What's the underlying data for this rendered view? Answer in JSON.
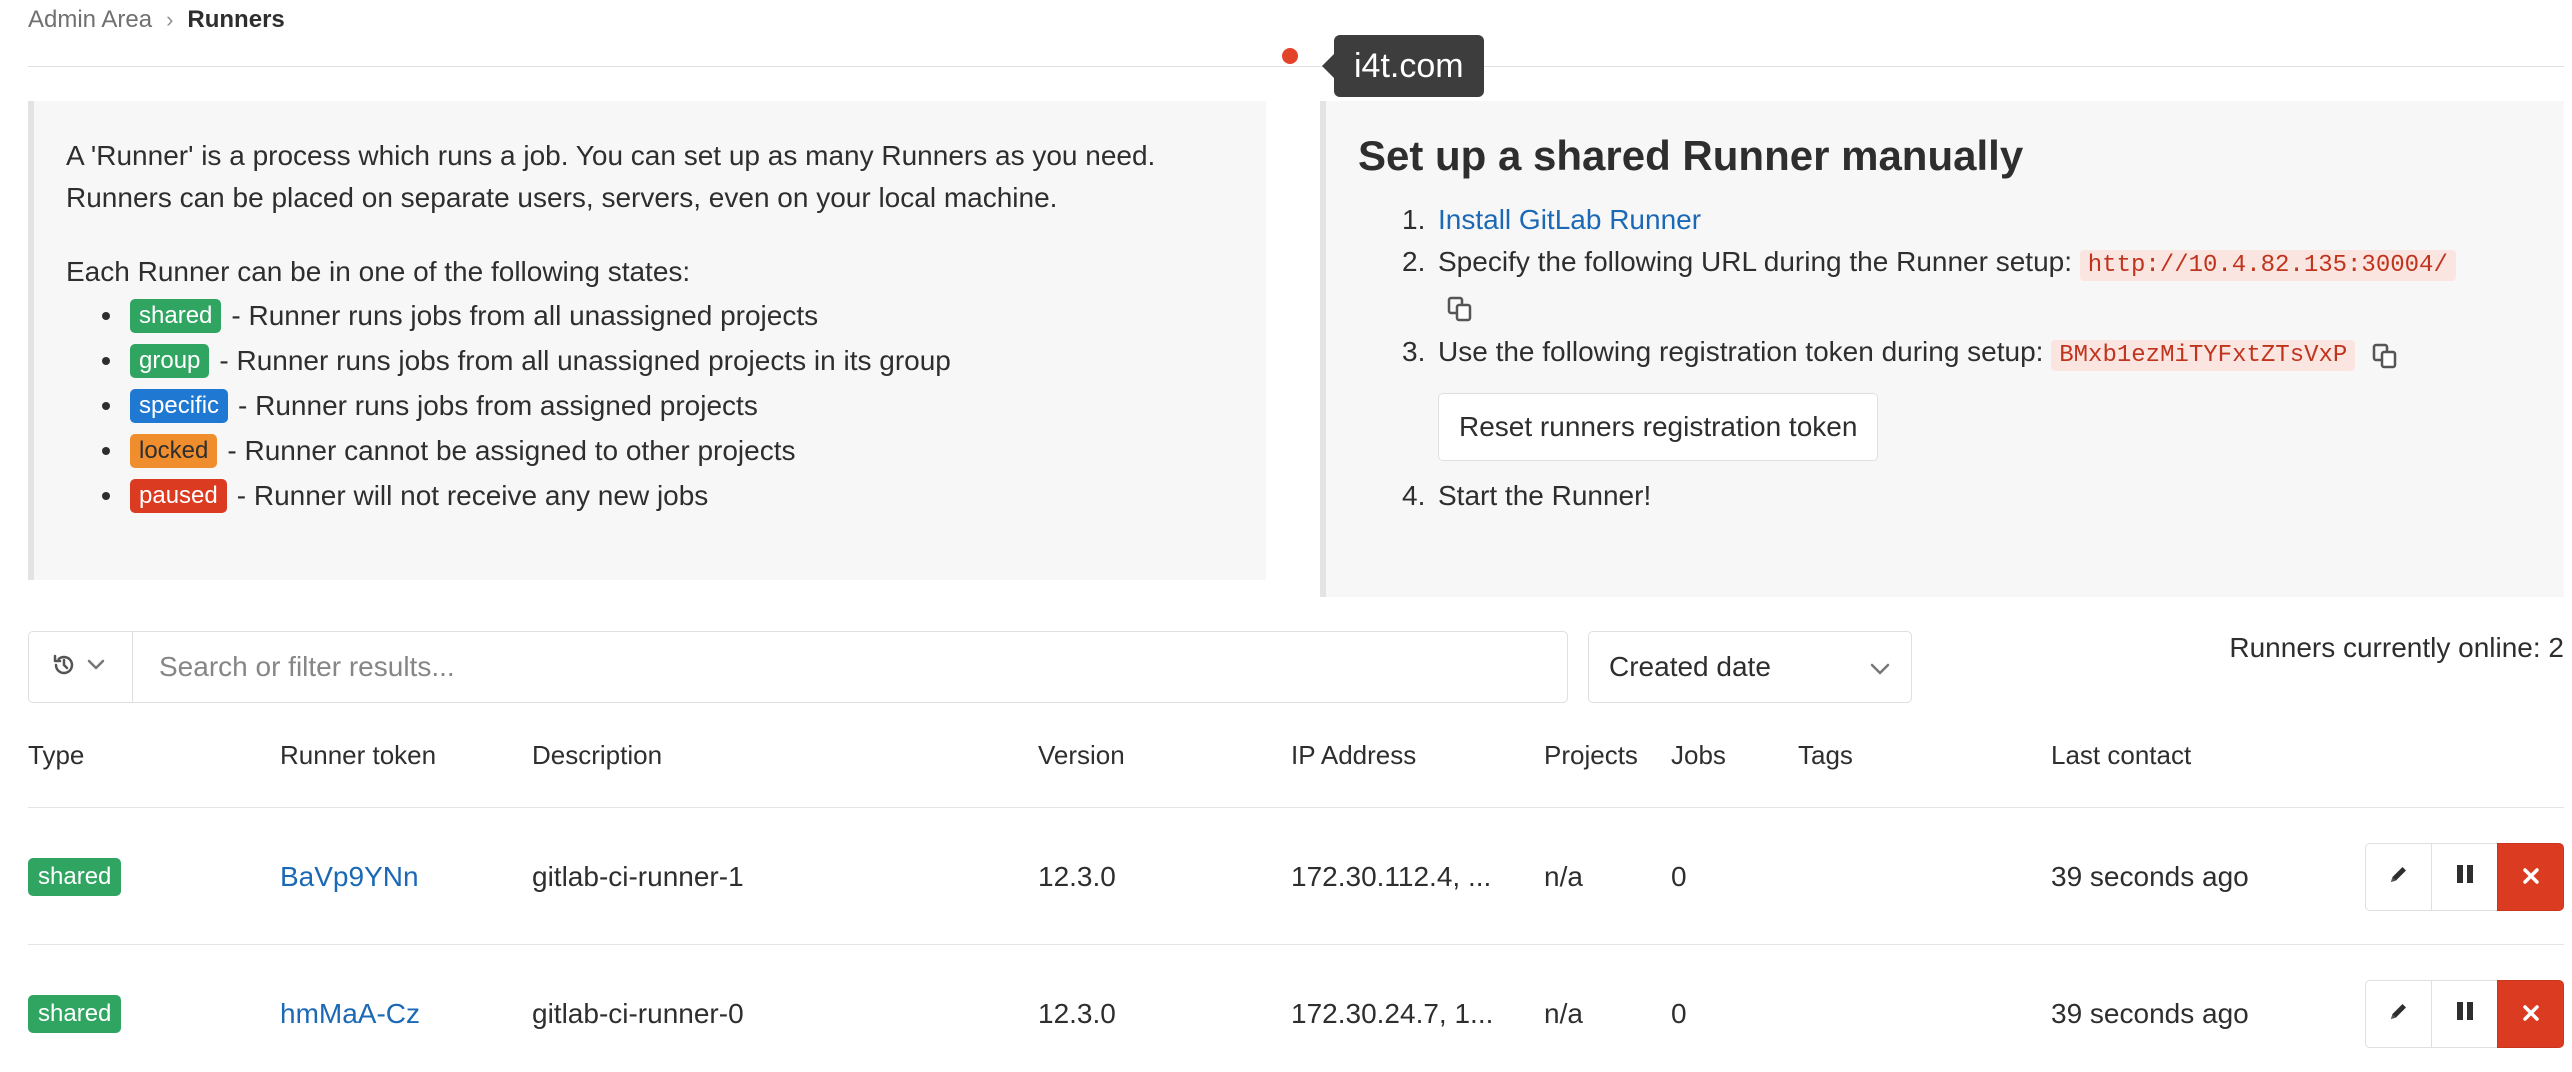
{
  "breadcrumb": {
    "parent": "Admin Area",
    "separator": "›",
    "current": "Runners"
  },
  "overlay": {
    "tooltip": "i4t.com"
  },
  "info_panel": {
    "intro": "A 'Runner' is a process which runs a job. You can set up as many Runners as you need. Runners can be placed on separate users, servers, even on your local machine.",
    "states_intro": "Each Runner can be in one of the following states:",
    "states": [
      {
        "badge": "shared",
        "text": "- Runner runs jobs from all unassigned projects",
        "color": "#2fa561"
      },
      {
        "badge": "group",
        "text": "- Runner runs jobs from all unassigned projects in its group",
        "color": "#2fa561"
      },
      {
        "badge": "specific",
        "text": "- Runner runs jobs from assigned projects",
        "color": "#1f78d1"
      },
      {
        "badge": "locked",
        "text": "- Runner cannot be assigned to other projects",
        "color": "#f08e2d"
      },
      {
        "badge": "paused",
        "text": "- Runner will not receive any new jobs",
        "color": "#db3b21"
      }
    ]
  },
  "setup_panel": {
    "title": "Set up a shared Runner manually",
    "step1_link": "Install GitLab Runner",
    "step2_text": "Specify the following URL during the Runner setup:",
    "step2_url": "http://10.4.82.135:30004/",
    "step3_text": "Use the following registration token during setup:",
    "step3_token": "BMxb1ezMiTYFxtZTsVxP",
    "reset_button": "Reset runners registration token",
    "step4_text": "Start the Runner!",
    "step_numbers": [
      "1.",
      "2.",
      "3.",
      "4."
    ]
  },
  "filter": {
    "search_placeholder": "Search or filter results...",
    "sort_label": "Created date",
    "online_text": "Runners currently online: 2"
  },
  "table": {
    "headers": {
      "type": "Type",
      "token": "Runner token",
      "description": "Description",
      "version": "Version",
      "ip": "IP Address",
      "projects": "Projects",
      "jobs": "Jobs",
      "tags": "Tags",
      "last_contact": "Last contact"
    },
    "rows": [
      {
        "type": "shared",
        "token": "BaVp9YNn",
        "description": "gitlab-ci-runner-1",
        "version": "12.3.0",
        "ip": "172.30.112.4, ...",
        "projects": "n/a",
        "jobs": "0",
        "tags": "",
        "last_contact": "39 seconds ago"
      },
      {
        "type": "shared",
        "token": "hmMaA-Cz",
        "description": "gitlab-ci-runner-0",
        "version": "12.3.0",
        "ip": "172.30.24.7, 1...",
        "projects": "n/a",
        "jobs": "0",
        "tags": "",
        "last_contact": "39 seconds ago"
      }
    ]
  },
  "icons": {
    "history": "history-icon",
    "chevron": "chevron-down-icon",
    "copy": "copy-icon",
    "edit": "pencil-icon",
    "pause": "pause-icon",
    "remove": "close-icon"
  },
  "colors": {
    "link": "#1b69b6",
    "success": "#2fa561",
    "danger": "#db3b21",
    "warning": "#f08e2d",
    "info": "#1f78d1"
  }
}
